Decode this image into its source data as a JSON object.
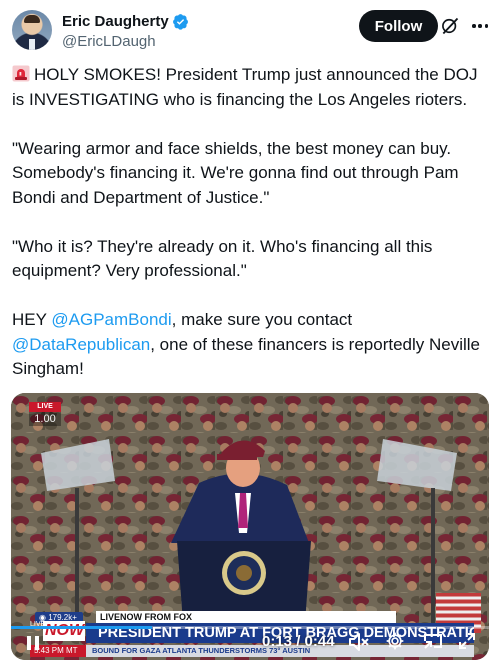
{
  "author": {
    "name": "Eric Daugherty",
    "handle": "@EricLDaugh",
    "verified": true,
    "follow_label": "Follow"
  },
  "icons": {
    "avatar": "avatar",
    "verified": "verified-badge-icon",
    "grok": "grok-icon",
    "more": "more-options-icon",
    "siren": "siren-emoji-icon",
    "pause": "pause-icon",
    "volume": "volume-muted-icon",
    "settings": "settings-icon",
    "pip": "picture-in-picture-icon",
    "fullscreen": "fullscreen-icon"
  },
  "tweet": {
    "p1": "HOLY SMOKES! President Trump just announced the DOJ is INVESTIGATING who is financing the Los Angeles rioters.",
    "p2": "\"Wearing armor and face shields, the best money can buy. Somebody's financing it. We're gonna find out through Pam Bondi and Department of Justice.\"",
    "p3": "\"Who it is? They're already on it. Who's financing all this equipment? Very professional.\"",
    "p4_before": "HEY ",
    "p4_mention1": "@AGPamBondi",
    "p4_middle": ", make sure you contact",
    "p4_mention2": "@DataRepublican",
    "p4_after": ", one of these financers is reportedly Neville Singham!"
  },
  "video": {
    "live_badge": "LIVE",
    "playback_rate": "1.00",
    "views": "179.2k+",
    "source_label": "LIVENOW FROM FOX",
    "live_small": "LIVE",
    "now_label": "NOW",
    "headline": "PRESIDENT TRUMP AT FORT BRAGG DEMONSTRATION",
    "clock": "5:43 PM MT",
    "ticker": "BOUND FOR GAZA    ATLANTA    THUNDERSTORMS 73°    AUSTIN",
    "time_display": "0:13 / 0:44",
    "progress_fraction": 0.295
  },
  "colors": {
    "text": "#0f1419",
    "secondary": "#536471",
    "link": "#1d9bf0",
    "follow_bg": "#0f1419",
    "chyron_blue": "#1a3b8c",
    "chyron_red": "#c9182b"
  }
}
